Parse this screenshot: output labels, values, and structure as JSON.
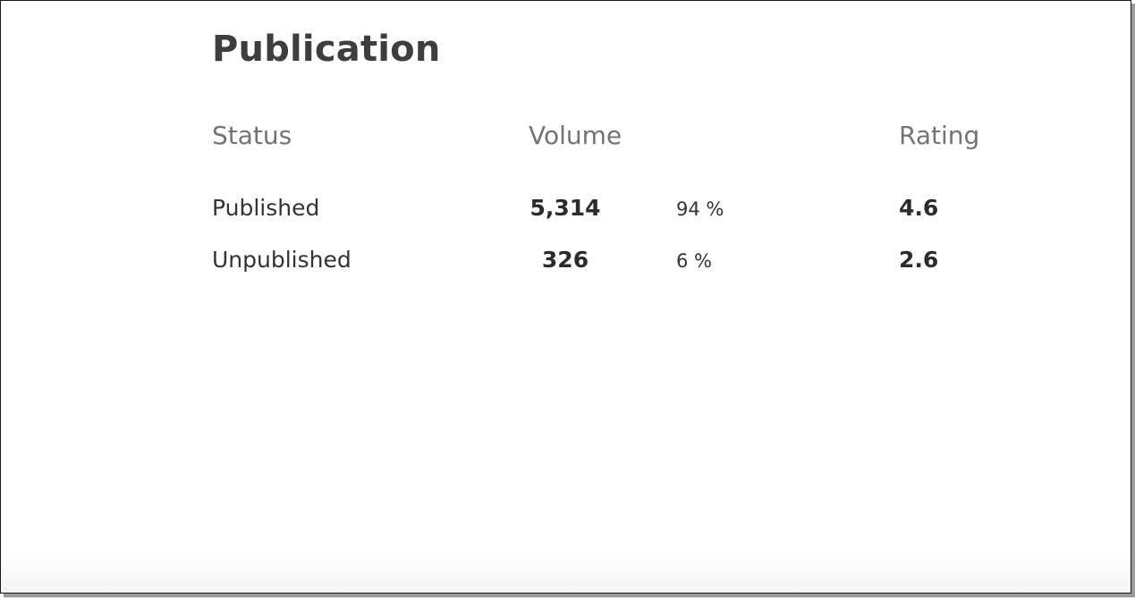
{
  "title": "Publication",
  "columns": {
    "status": "Status",
    "volume": "Volume",
    "rating": "Rating"
  },
  "rows": [
    {
      "status": "Published",
      "volume": "5,314",
      "percent": "94 %",
      "rating": "4.6"
    },
    {
      "status": "Unpublished",
      "volume": "326",
      "percent": "6 %",
      "rating": "2.6"
    }
  ]
}
